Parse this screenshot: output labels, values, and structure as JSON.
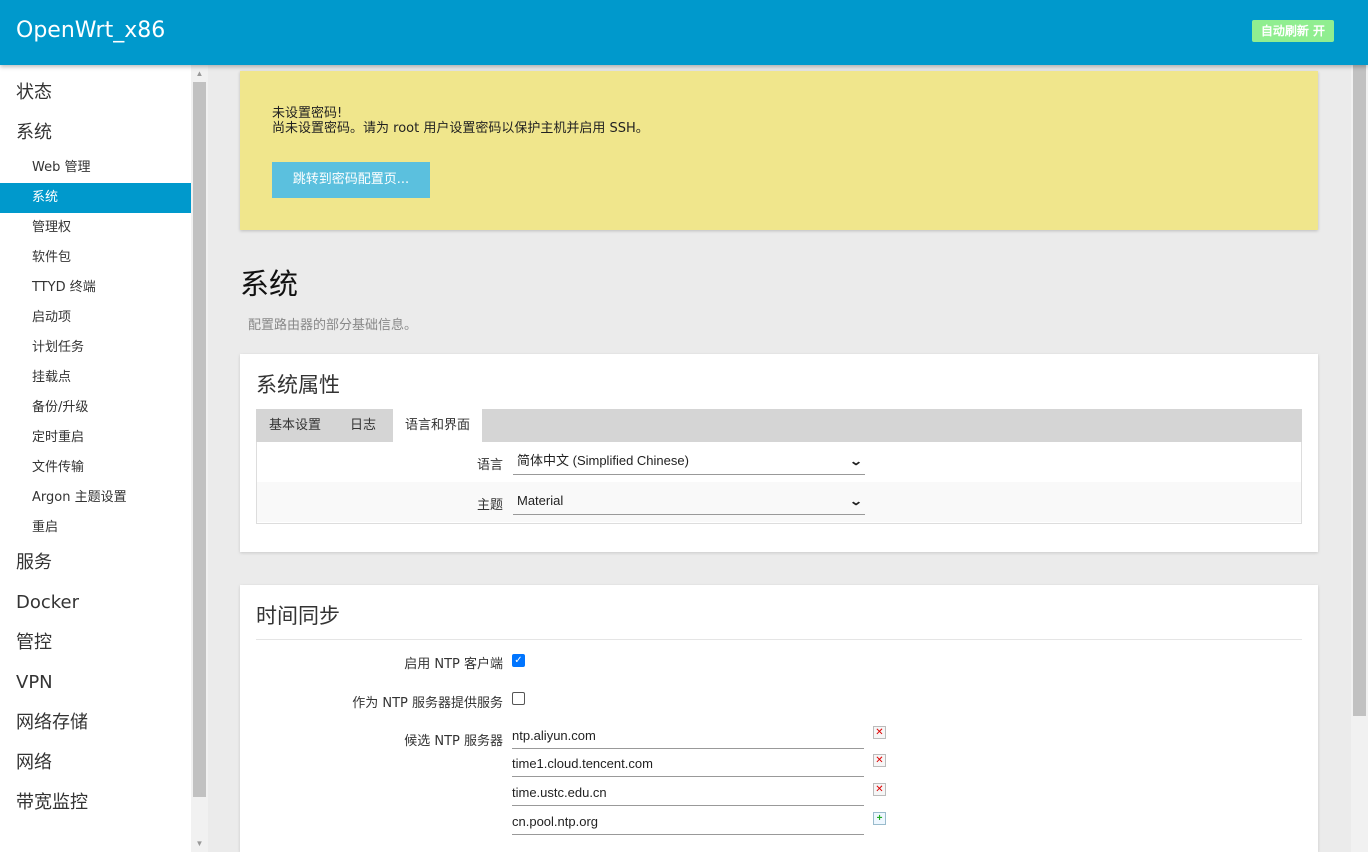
{
  "header": {
    "brand": "OpenWrt_x86",
    "refresh_label": "自动刷新 开"
  },
  "sidebar": {
    "top_items": [
      "状态",
      "系统"
    ],
    "sub_items": [
      "Web 管理",
      "系统",
      "管理权",
      "软件包",
      "TTYD 终端",
      "启动项",
      "计划任务",
      "挂载点",
      "备份/升级",
      "定时重启",
      "文件传输",
      "Argon 主题设置",
      "重启"
    ],
    "active_sub": "系统",
    "bottom_items": [
      "服务",
      "Docker",
      "管控",
      "VPN",
      "网络存储",
      "网络",
      "带宽监控"
    ]
  },
  "alert": {
    "title": "未设置密码!",
    "message": "尚未设置密码。请为 root 用户设置密码以保护主机并启用 SSH。",
    "button": "跳转到密码配置页..."
  },
  "page": {
    "title": "系统",
    "description": "配置路由器的部分基础信息。"
  },
  "system_properties": {
    "title": "系统属性",
    "tabs": [
      "基本设置",
      "日志",
      "语言和界面"
    ],
    "active_tab": "语言和界面",
    "language_label": "语言",
    "language_value": "简体中文 (Simplified Chinese)",
    "theme_label": "主题",
    "theme_value": "Material"
  },
  "time_sync": {
    "title": "时间同步",
    "enable_ntp_label": "启用 NTP 客户端",
    "enable_ntp_checked": true,
    "ntp_server_label": "作为 NTP 服务器提供服务",
    "ntp_server_checked": false,
    "candidates_label": "候选 NTP 服务器",
    "servers": [
      "ntp.aliyun.com",
      "time1.cloud.tencent.com",
      "time.ustc.edu.cn",
      "cn.pool.ntp.org"
    ]
  },
  "colors": {
    "accent": "#0099cc",
    "alert_bg": "#f0e68c",
    "alert_button": "#5bc0de",
    "refresh_button": "#90ee90"
  }
}
